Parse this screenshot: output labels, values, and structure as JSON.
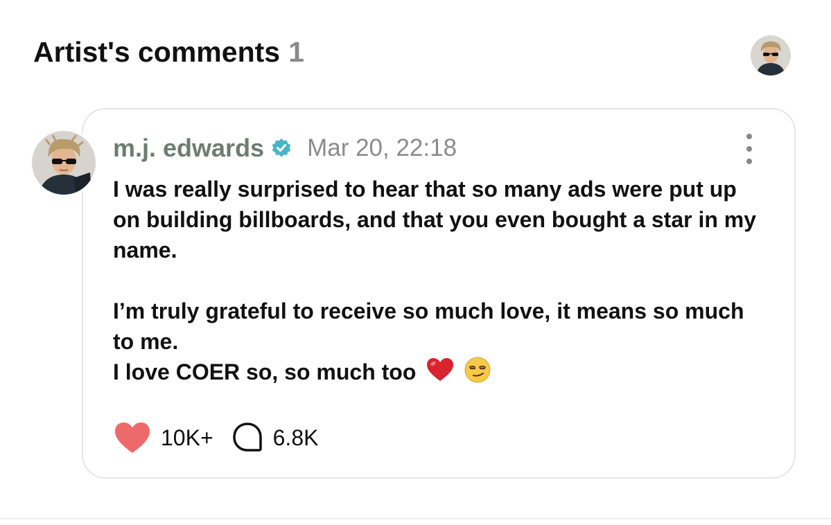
{
  "header": {
    "title": "Artist's comments",
    "count": "1"
  },
  "comment": {
    "author": "m.j. edwards",
    "verified": true,
    "date": "Mar 20, 22:18",
    "paragraphs": [
      "I was really surprised to hear that so many ads were put up on building billboards, and that you even bought a star in my name.",
      "I’m truly grateful to receive so much love, it means so much to me.",
      "I love COER so, so much too"
    ],
    "emojis": [
      "red-heart-emoji",
      "smirking-face-emoji"
    ],
    "likes": "10K+",
    "replies": "6.8K"
  },
  "colors": {
    "author_name": "#6d7d70",
    "verified_badge": "#4bb5c8",
    "like_heart": "#ee6a6a",
    "muted_text": "#8b8b8b"
  },
  "icons": {
    "more": "more-vertical-icon",
    "like": "heart-icon",
    "reply": "speech-bubble-icon",
    "verified": "verified-badge-icon"
  }
}
